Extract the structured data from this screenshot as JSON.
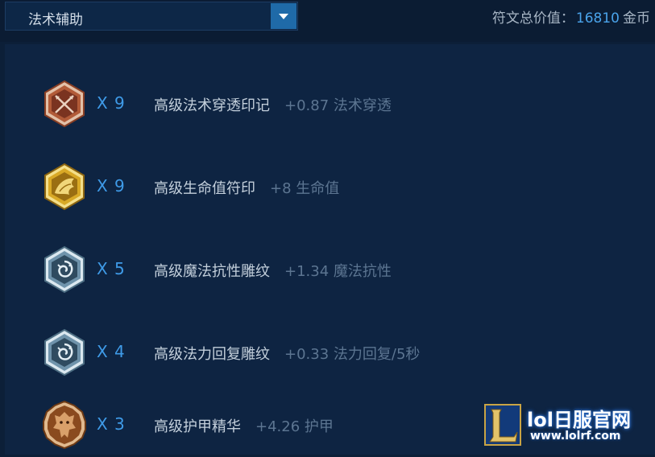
{
  "header": {
    "dropdown_value": "法术辅助",
    "total_label": "符文总价值：",
    "total_value": "16810",
    "total_unit": "金币"
  },
  "runes": [
    {
      "count": "X 9",
      "name": "高级法术穿透印记",
      "stat": "+0.87 法术穿透",
      "icon": "crossed-arrows-mark-icon",
      "color": "#c0684a"
    },
    {
      "count": "X 9",
      "name": "高级生命值符印",
      "stat": "+8 生命值",
      "icon": "wing-seal-icon",
      "color": "#d8a82a"
    },
    {
      "count": "X 5",
      "name": "高级魔法抗性雕纹",
      "stat": "+1.34 魔法抗性",
      "icon": "spiral-glyph-icon",
      "color": "#8fb0c4"
    },
    {
      "count": "X 4",
      "name": "高级法力回复雕纹",
      "stat": "+0.33 法力回复/5秒",
      "icon": "spiral-glyph-icon",
      "color": "#8fb0c4"
    },
    {
      "count": "X 3",
      "name": "高级护甲精华",
      "stat": "+4.26 护甲",
      "icon": "dragon-quintessence-icon",
      "color": "#b8733a"
    }
  ],
  "watermark": {
    "title": "lol日服官网",
    "url": "www.lolrf.com"
  }
}
